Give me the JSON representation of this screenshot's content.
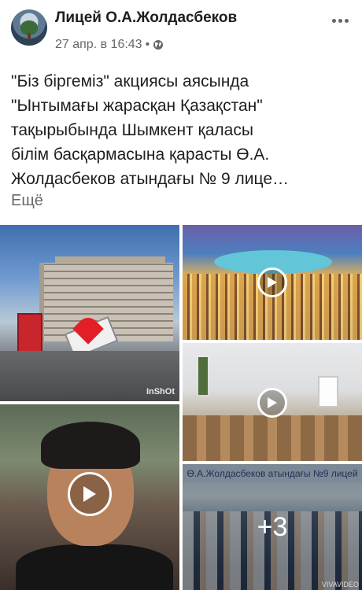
{
  "post": {
    "author": "Лицей О.А.Жолдасбеков",
    "timestamp": "27 апр. в 16:43",
    "separator": "•",
    "privacy_icon": "globe-icon",
    "more_icon": "more-options-icon",
    "text_lines": [
      "\"Біз біргеміз\" акциясы аясында",
      "\"Ынтымағы жарасқан Қазақстан\"",
      "тақырыбында Шымкент қаласы",
      "білім басқармасына қарасты Ө.А.",
      "Жолдасбеков атындағы № 9 лице…"
    ],
    "see_more": "Ещё"
  },
  "media": {
    "tile1": {
      "watermark": "InShOt"
    },
    "tile2": {
      "icon": "play-icon"
    },
    "tile3": {
      "icon": "play-icon"
    },
    "tile4": {
      "icon": "play-icon"
    },
    "tile5": {
      "banner": "Ө.А.Жолдасбеков атындағы №9 лицей",
      "more_count": "+3",
      "watermark": "VIVAVIDEO"
    }
  },
  "colors": {
    "text": "#1c1e21",
    "secondary": "#65676b",
    "background": "#ffffff"
  }
}
